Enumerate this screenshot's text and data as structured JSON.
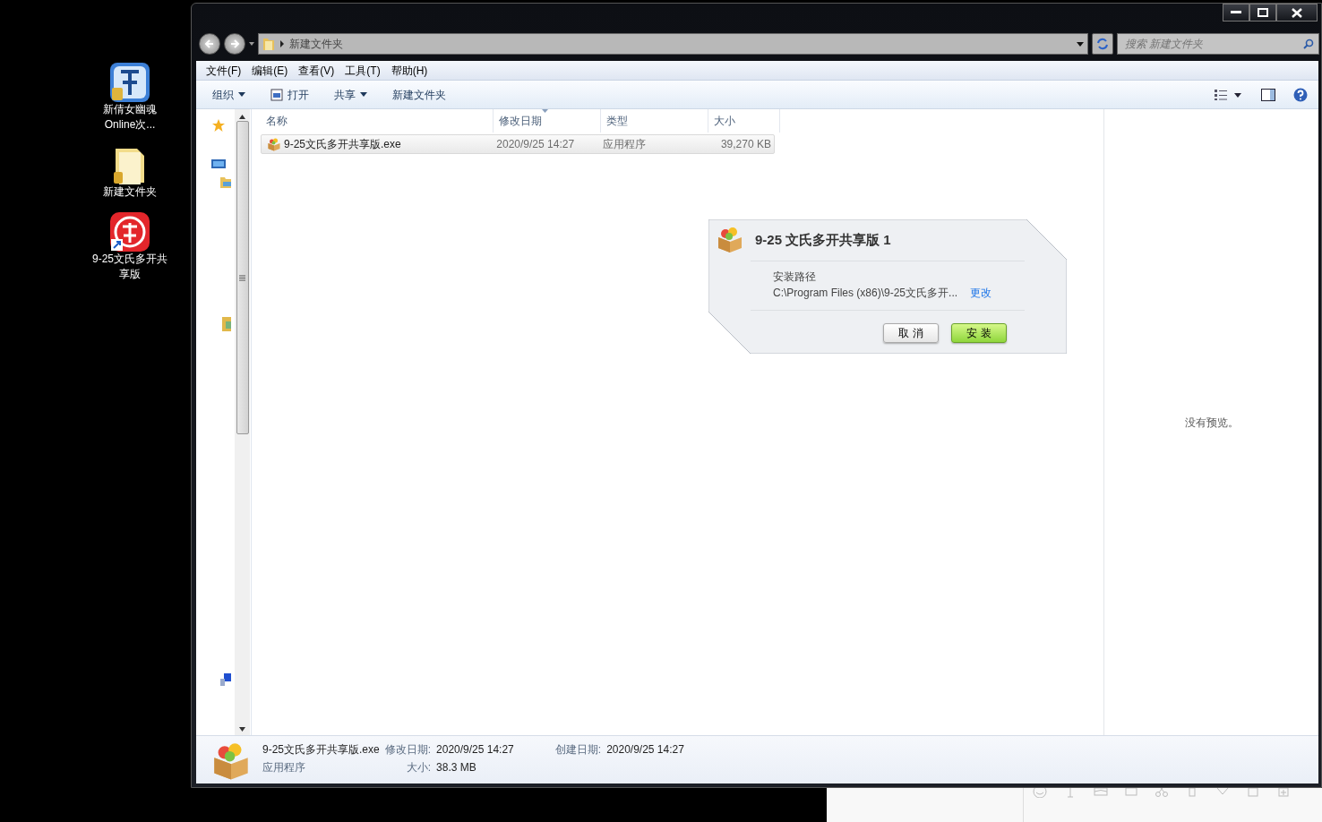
{
  "desktop_icons": [
    {
      "label": "新倩女幽魂 Online次...",
      "kind": "game"
    },
    {
      "label": "新建文件夹",
      "kind": "folder"
    },
    {
      "label": "9-25文氏多开共享版",
      "kind": "app"
    }
  ],
  "window": {
    "address": {
      "crumb": "新建文件夹"
    },
    "search": {
      "placeholder": "搜索 新建文件夹"
    },
    "menu": [
      "文件(F)",
      "编辑(E)",
      "查看(V)",
      "工具(T)",
      "帮助(H)"
    ],
    "toolbar": [
      {
        "label": "组织",
        "kind": "dropdown"
      },
      {
        "label": "打开",
        "kind": "open"
      },
      {
        "label": "共享",
        "kind": "dropdown"
      },
      {
        "label": "新建文件夹",
        "kind": "plain"
      }
    ],
    "columns": [
      {
        "label": "名称",
        "sorted": false
      },
      {
        "label": "修改日期",
        "sorted": true
      },
      {
        "label": "类型",
        "sorted": false
      },
      {
        "label": "大小",
        "sorted": false
      }
    ],
    "files": [
      {
        "name": "9-25文氏多开共享版.exe",
        "date": "2020/9/25 14:27",
        "type": "应用程序",
        "size": "39,270 KB",
        "selected": true
      }
    ],
    "preview": {
      "message": "没有预览。"
    },
    "details": {
      "name": "9-25文氏多开共享版.exe",
      "type": "应用程序",
      "modified_label": "修改日期:",
      "modified": "2020/9/25 14:27",
      "created_label": "创建日期:",
      "created": "2020/9/25 14:27",
      "size_label": "大小:",
      "size": "38.3 MB"
    }
  },
  "dialog": {
    "title": "9-25 文氏多开共享版 1",
    "path_label": "安装路径",
    "path": "C:\\Program  Files  (x86)\\9-25文氏多开...",
    "change_link": "更改",
    "buttons": [
      {
        "label": "取 消",
        "kind": "secondary"
      },
      {
        "label": "安 装",
        "kind": "primary"
      }
    ]
  }
}
